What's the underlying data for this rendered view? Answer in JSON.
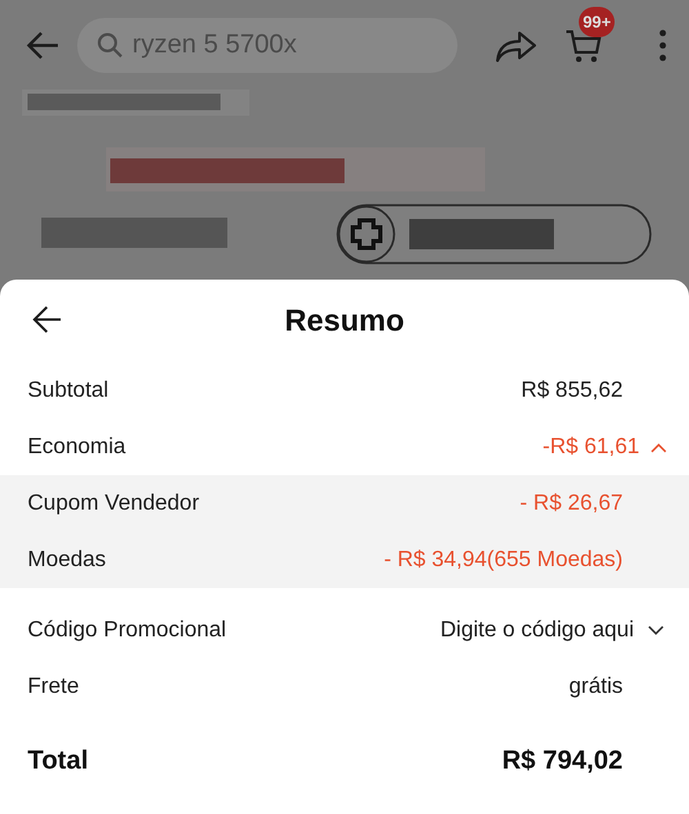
{
  "top_bar": {
    "search": {
      "placeholder": "ryzen 5 5700x"
    },
    "cart_badge": "99+"
  },
  "summary": {
    "title": "Resumo",
    "rows": [
      {
        "kind": "line",
        "label": "Subtotal",
        "value": "R$ 855,62",
        "accent": false
      },
      {
        "kind": "expander",
        "label": "Economia",
        "value": "-R$ 61,61",
        "accent": true,
        "expanded": true,
        "children": [
          {
            "label": "Cupom Vendedor",
            "value": "- R$ 26,67"
          },
          {
            "label": "Moedas",
            "value": "- R$ 34,94(655 Moedas)"
          }
        ]
      },
      {
        "kind": "dropdown",
        "label": "Código Promocional",
        "placeholder": "Digite o código aqui"
      },
      {
        "kind": "line",
        "label": "Frete",
        "value": "grátis",
        "accent": false
      },
      {
        "kind": "total",
        "label": "Total",
        "value": "R$ 794,02"
      }
    ]
  }
}
